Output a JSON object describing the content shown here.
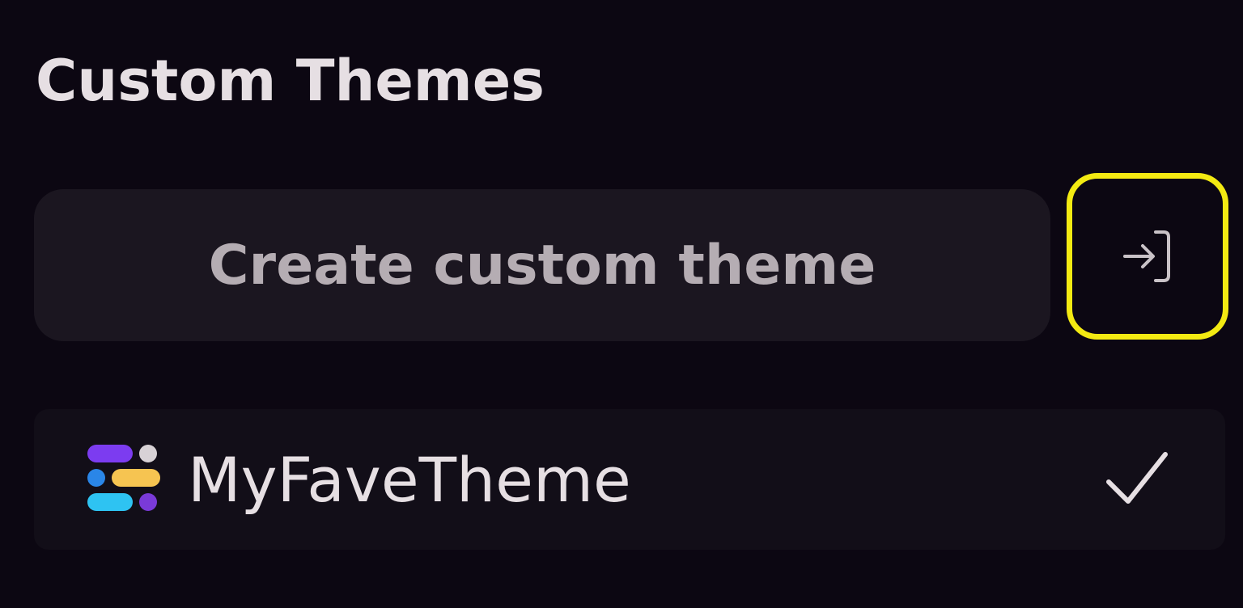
{
  "section": {
    "title": "Custom Themes"
  },
  "create": {
    "label": "Create custom theme",
    "import_icon": "import-arrow-icon"
  },
  "themes": {
    "items": [
      {
        "name": "MyFaveTheme",
        "icon": "theme-palette-icon",
        "selected": true,
        "selected_icon": "checkmark-icon"
      }
    ]
  },
  "colors": {
    "background": "#0c0712",
    "focus_ring": "#f3ea12",
    "button_bg": "#1b1620",
    "text_primary": "#e6dfe3",
    "text_muted": "#b5adb3"
  }
}
